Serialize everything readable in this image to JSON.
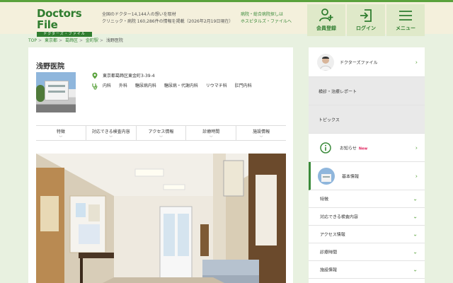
{
  "header": {
    "logo": "Doctors File",
    "logo_sub": "ドクターズ・ファイル",
    "tagline_1": "全国のドクター14,144人の想いを取材",
    "tagline_2": "クリニック・病院 160,286件の情報を掲載（2026年2月19日現在）",
    "hospital_link_1": "病院・総合病院探しは",
    "hospital_link_2": "ホスピタルズ・ファイルへ",
    "buttons": {
      "member": "会員登録",
      "login": "ログイン",
      "menu": "メニュー"
    }
  },
  "breadcrumb": [
    "TOP",
    "東京都",
    "葛飾区",
    "金町駅",
    "浅野医院"
  ],
  "clinic": {
    "name": "浅野医院",
    "address": "東京都葛飾区東金町3-39-4",
    "departments": [
      "内科",
      "外科",
      "糖尿病内科",
      "糖尿病・代謝内科",
      "リウマチ科",
      "肛門内科"
    ]
  },
  "tabs": [
    "特徴",
    "対応できる検査内容",
    "アクセス情報",
    "診療時間",
    "施設情報"
  ],
  "sidebar": {
    "doctors_file": "ドクターズファイル",
    "report": "検診・治療レポート",
    "topics": "トピックス",
    "notice": "お知らせ",
    "notice_badge": "New",
    "basic_info": "基本情報",
    "sub_items": [
      "特徴",
      "対応できる検査内容",
      "アクセス情報",
      "診療時間",
      "施設情報"
    ]
  },
  "colors": {
    "brand_green": "#2f7d2f",
    "accent_green": "#5aa23c",
    "header_bg": "#f4f0dc",
    "page_bg": "#e8f1e0",
    "new_badge": "#e0245e"
  },
  "icons": {
    "member": "person-plus-icon",
    "login": "login-arrow-icon",
    "menu": "hamburger-icon",
    "address": "map-pin-icon",
    "department": "stethoscope-icon",
    "notice": "info-circle-icon",
    "chevron": "chevron-right-icon"
  }
}
